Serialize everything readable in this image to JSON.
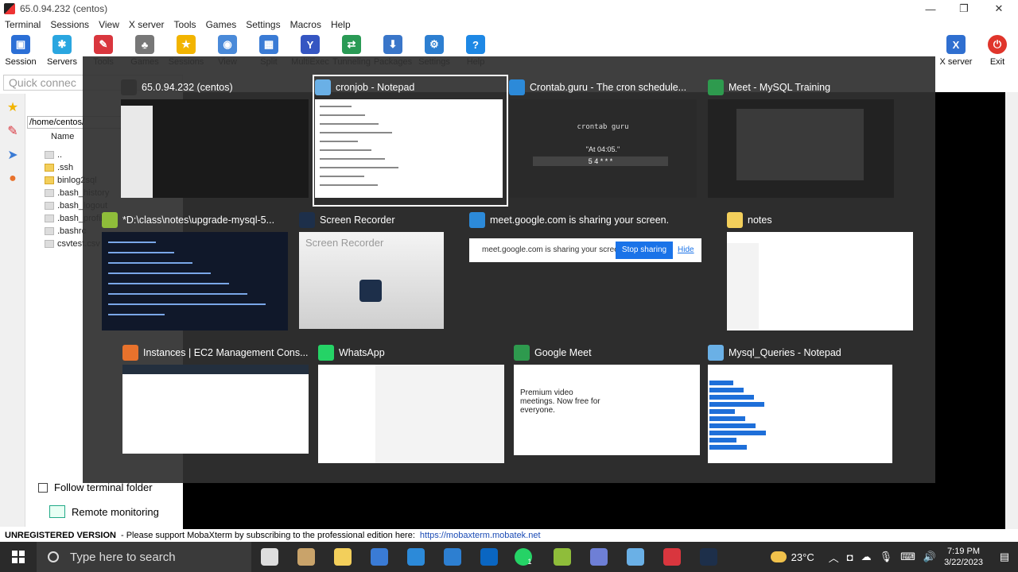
{
  "window": {
    "title": "65.0.94.232 (centos)"
  },
  "menu": [
    "Terminal",
    "Sessions",
    "View",
    "X server",
    "Tools",
    "Games",
    "Settings",
    "Macros",
    "Help"
  ],
  "toolbar": {
    "left": [
      {
        "label": "Session",
        "icon": "session-icon",
        "color": "#2b6fd6"
      },
      {
        "label": "Servers",
        "icon": "servers-icon",
        "color": "#2aa6e0"
      },
      {
        "label": "Tools",
        "icon": "tools-icon",
        "color": "#d9363e"
      },
      {
        "label": "Games",
        "icon": "games-icon",
        "color": "#777777"
      },
      {
        "label": "Sessions",
        "icon": "star-icon",
        "color": "#f2b400"
      },
      {
        "label": "View",
        "icon": "view-icon",
        "color": "#4a8ad9"
      },
      {
        "label": "Split",
        "icon": "split-icon",
        "color": "#3a7bd5"
      },
      {
        "label": "MultiExec",
        "icon": "multiexec-icon",
        "color": "#3556c2"
      },
      {
        "label": "Tunneling",
        "icon": "tunneling-icon",
        "color": "#2a9a55"
      },
      {
        "label": "Packages",
        "icon": "packages-icon",
        "color": "#3a76c9"
      },
      {
        "label": "Settings",
        "icon": "gear-icon",
        "color": "#2d7fd1"
      },
      {
        "label": "Help",
        "icon": "help-icon",
        "color": "#1e88e5"
      }
    ],
    "right": [
      {
        "label": "X server",
        "icon": "x-server-icon",
        "color": "#2f6fd0"
      },
      {
        "label": "Exit",
        "icon": "power-icon",
        "color": "#e0352b"
      }
    ]
  },
  "quick_connect": {
    "placeholder": "Quick connec"
  },
  "sidebar": {
    "path": "/home/centos/",
    "name_header": "Name",
    "files": [
      {
        "name": "..",
        "type": "up"
      },
      {
        "name": ".ssh",
        "type": "folder"
      },
      {
        "name": "binlog2sql",
        "type": "folder"
      },
      {
        "name": ".bash_history",
        "type": "file"
      },
      {
        "name": ".bash_logout",
        "type": "file"
      },
      {
        "name": ".bash_profile",
        "type": "file"
      },
      {
        "name": ".bashrc",
        "type": "file"
      },
      {
        "name": "csvtest.csv",
        "type": "file"
      }
    ],
    "follow_label": "Follow terminal folder",
    "remote_label": "Remote monitoring"
  },
  "switcher": {
    "windows": [
      {
        "title": "65.0.94.232 (centos)",
        "icon": "mobaxterm-icon",
        "color": "#333333",
        "selected": false
      },
      {
        "title": "cronjob - Notepad",
        "icon": "notepad-icon",
        "color": "#6ab0e6",
        "selected": true
      },
      {
        "title": "Crontab.guru - The cron schedule...",
        "icon": "edge-icon",
        "color": "#2c8ad9",
        "selected": false
      },
      {
        "title": "Meet - MySQL Training",
        "icon": "meet-icon",
        "color": "#2e9a4e",
        "selected": false
      },
      {
        "title": "*D:\\class\\notes\\upgrade-mysql-5...",
        "icon": "notepadpp-icon",
        "color": "#8fbd3a",
        "selected": false
      },
      {
        "title": "Screen Recorder",
        "icon": "screen-recorder-icon",
        "color": "#1d2f4a",
        "selected": false
      },
      {
        "title": "meet.google.com is sharing your screen.",
        "icon": "edge-icon",
        "color": "#2c8ad9",
        "selected": false
      },
      {
        "title": "notes",
        "icon": "folder-icon",
        "color": "#f3cf5b",
        "selected": false
      },
      {
        "title": "Instances | EC2 Management Cons...",
        "icon": "aws-icon",
        "color": "#e8722c",
        "selected": false
      },
      {
        "title": "WhatsApp",
        "icon": "whatsapp-icon",
        "color": "#25d366",
        "selected": false
      },
      {
        "title": "Google Meet",
        "icon": "meet-icon",
        "color": "#2e9a4e",
        "selected": false
      },
      {
        "title": "Mysql_Queries - Notepad",
        "icon": "notepad-icon",
        "color": "#6ab0e6",
        "selected": false
      }
    ],
    "screen_recorder_label": "Screen Recorder",
    "sharing_bar": {
      "text": "meet.google.com is sharing your screen.",
      "stop": "Stop sharing",
      "hide": "Hide"
    },
    "crontab_preview": {
      "heading": "crontab guru",
      "expression": "\"At 04:05.\"",
      "fields": "5  4  *  *  *"
    },
    "meet_preview": {
      "headline": "Premium video meetings. Now free for everyone."
    }
  },
  "statusbar": {
    "unregistered": "UNREGISTERED VERSION",
    "message": "-  Please support MobaXterm by subscribing to the professional edition here:",
    "link": "https://mobaxterm.mobatek.net"
  },
  "taskbar": {
    "search_placeholder": "Type here to search",
    "apps": [
      {
        "icon": "task-view-icon",
        "color": "#dddddd"
      },
      {
        "icon": "lamp-icon",
        "color": "#c9a36a"
      },
      {
        "icon": "file-explorer-icon",
        "color": "#f3cf5b"
      },
      {
        "icon": "store-icon",
        "color": "#3a7bd5"
      },
      {
        "icon": "edge-icon",
        "color": "#2c8ad9"
      },
      {
        "icon": "mail-icon",
        "color": "#2d7fd1"
      },
      {
        "icon": "linkedin-icon",
        "color": "#0a66c2"
      },
      {
        "icon": "whatsapp-icon",
        "color": "#25d366"
      },
      {
        "icon": "notepadpp-icon",
        "color": "#8fbd3a"
      },
      {
        "icon": "network-icon",
        "color": "#6e7fd6"
      },
      {
        "icon": "notepad-icon",
        "color": "#6ab0e6"
      },
      {
        "icon": "mobaxterm-icon",
        "color": "#d9363e"
      },
      {
        "icon": "screen-recorder-icon",
        "color": "#1d2f4a"
      }
    ],
    "whatsapp_badge": "1",
    "weather": "23°C",
    "time": "7:19 PM",
    "date": "3/22/2023"
  }
}
